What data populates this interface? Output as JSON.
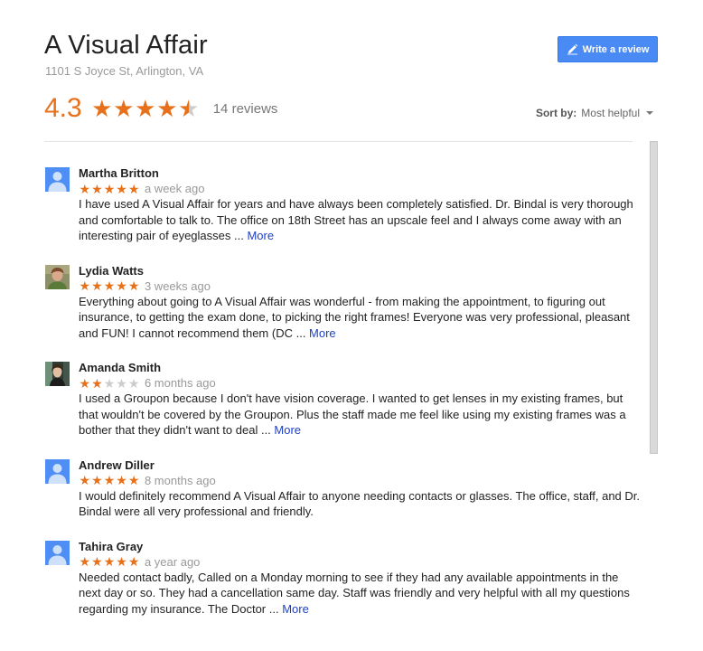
{
  "business": {
    "name": "A Visual Affair",
    "address": "1101 S Joyce St, Arlington, VA"
  },
  "write_review_label": "Write a review",
  "summary": {
    "rating": "4.3",
    "rating_value": 4.3,
    "review_count": "14 reviews"
  },
  "sort": {
    "label": "Sort by:",
    "value": "Most helpful"
  },
  "colors": {
    "accent": "#e7711b",
    "button": "#4a8af4",
    "link": "#1e40c8"
  },
  "reviews": [
    {
      "name": "Martha Britton",
      "avatar": "default-avatar",
      "stars": 5,
      "date": "a week ago",
      "text": "I have used A Visual Affair for years and have always been completely satisfied. Dr. Bindal is very thorough and comfortable to talk to. The office on 18th Street has an upscale feel and I always come away with an interesting pair of eyeglasses ... ",
      "more": "More"
    },
    {
      "name": "Lydia Watts",
      "avatar": "photo-avatar",
      "stars": 5,
      "date": "3 weeks ago",
      "text": "Everything about going to A Visual Affair was wonderful - from making the appointment, to figuring out insurance, to getting the exam done, to picking the right frames! Everyone was very professional, pleasant and FUN! I cannot recommend them (DC ... ",
      "more": "More"
    },
    {
      "name": "Amanda Smith",
      "avatar": "photo-avatar",
      "stars": 2,
      "date": "6 months ago",
      "text": "I used a Groupon because I don't have vision coverage. I wanted to get lenses in my existing frames, but that wouldn't be covered by the Groupon. Plus the staff made me feel like using my existing frames was a bother that they didn't want to deal ... ",
      "more": "More"
    },
    {
      "name": "Andrew Diller",
      "avatar": "default-avatar",
      "stars": 5,
      "date": "8 months ago",
      "text": "I would definitely recommend A Visual Affair to anyone needing contacts or glasses. The office, staff, and Dr. Bindal were all very professional and friendly.",
      "more": ""
    },
    {
      "name": "Tahira Gray",
      "avatar": "default-avatar",
      "stars": 5,
      "date": "a year ago",
      "text": "Needed contact badly, Called on a Monday morning to see if they had any available appointments in the next day or so. They had a cancellation same day. Staff was friendly and very helpful with all my questions regarding my insurance. The Doctor ... ",
      "more": "More"
    }
  ]
}
